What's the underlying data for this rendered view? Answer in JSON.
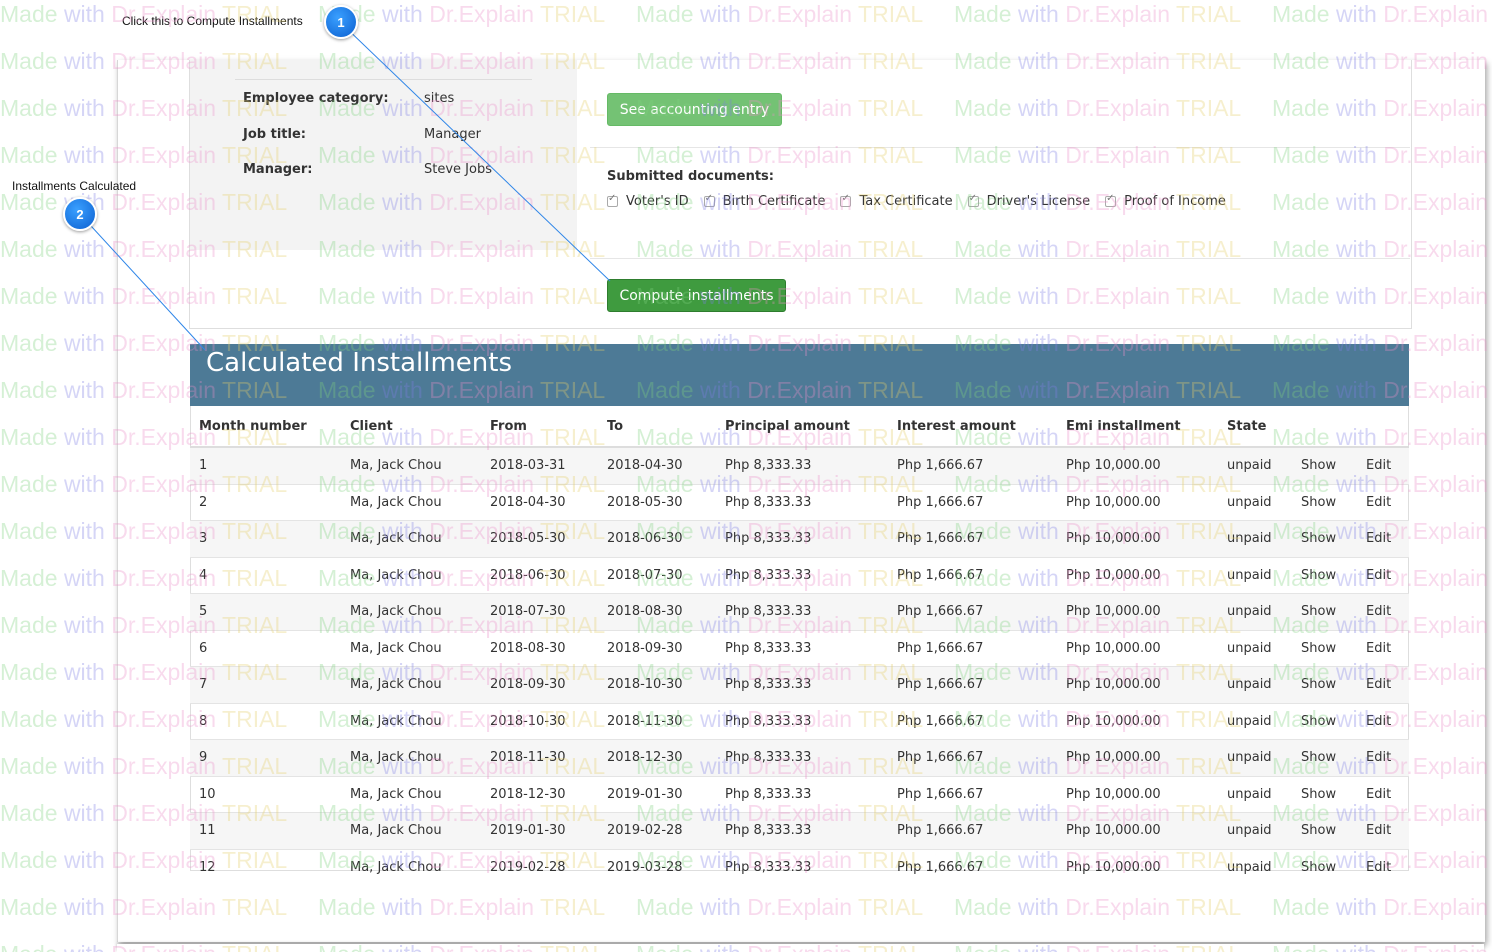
{
  "callouts": [
    {
      "number": "1",
      "text": "Click this to Compute Installments"
    },
    {
      "number": "2",
      "text": "Installments Calculated"
    }
  ],
  "employee": {
    "category_label": "Employee category:",
    "category_value": "sites",
    "job_title_label": "Job title:",
    "job_title_value": "Manager",
    "manager_label": "Manager:",
    "manager_value": "Steve Jobs"
  },
  "buttons": {
    "accounting_entry": "See accounting entry",
    "compute_installments": "Compute installments"
  },
  "documents": {
    "label": "Submitted documents:",
    "items": [
      {
        "label": "Voter's ID",
        "checked": true
      },
      {
        "label": "Birth Certificate",
        "checked": true
      },
      {
        "label": "Tax Certificate",
        "checked": true
      },
      {
        "label": "Driver's License",
        "checked": true
      },
      {
        "label": "Proof of Income",
        "checked": true
      }
    ]
  },
  "installments": {
    "title": "Calculated Installments",
    "columns": [
      "Month number",
      "Client",
      "From",
      "To",
      "Principal amount",
      "Interest amount",
      "Emi installment",
      "State",
      "",
      ""
    ],
    "show_label": "Show",
    "edit_label": "Edit",
    "rows": [
      {
        "month": "1",
        "client": "Ma, Jack Chou",
        "from": "2018-03-31",
        "to": "2018-04-30",
        "principal": "Php 8,333.33",
        "interest": "Php 1,666.67",
        "emi": "Php 10,000.00",
        "state": "unpaid"
      },
      {
        "month": "2",
        "client": "Ma, Jack Chou",
        "from": "2018-04-30",
        "to": "2018-05-30",
        "principal": "Php 8,333.33",
        "interest": "Php 1,666.67",
        "emi": "Php 10,000.00",
        "state": "unpaid"
      },
      {
        "month": "3",
        "client": "Ma, Jack Chou",
        "from": "2018-05-30",
        "to": "2018-06-30",
        "principal": "Php 8,333.33",
        "interest": "Php 1,666.67",
        "emi": "Php 10,000.00",
        "state": "unpaid"
      },
      {
        "month": "4",
        "client": "Ma, Jack Chou",
        "from": "2018-06-30",
        "to": "2018-07-30",
        "principal": "Php 8,333.33",
        "interest": "Php 1,666.67",
        "emi": "Php 10,000.00",
        "state": "unpaid"
      },
      {
        "month": "5",
        "client": "Ma, Jack Chou",
        "from": "2018-07-30",
        "to": "2018-08-30",
        "principal": "Php 8,333.33",
        "interest": "Php 1,666.67",
        "emi": "Php 10,000.00",
        "state": "unpaid"
      },
      {
        "month": "6",
        "client": "Ma, Jack Chou",
        "from": "2018-08-30",
        "to": "2018-09-30",
        "principal": "Php 8,333.33",
        "interest": "Php 1,666.67",
        "emi": "Php 10,000.00",
        "state": "unpaid"
      },
      {
        "month": "7",
        "client": "Ma, Jack Chou",
        "from": "2018-09-30",
        "to": "2018-10-30",
        "principal": "Php 8,333.33",
        "interest": "Php 1,666.67",
        "emi": "Php 10,000.00",
        "state": "unpaid"
      },
      {
        "month": "8",
        "client": "Ma, Jack Chou",
        "from": "2018-10-30",
        "to": "2018-11-30",
        "principal": "Php 8,333.33",
        "interest": "Php 1,666.67",
        "emi": "Php 10,000.00",
        "state": "unpaid"
      },
      {
        "month": "9",
        "client": "Ma, Jack Chou",
        "from": "2018-11-30",
        "to": "2018-12-30",
        "principal": "Php 8,333.33",
        "interest": "Php 1,666.67",
        "emi": "Php 10,000.00",
        "state": "unpaid"
      },
      {
        "month": "10",
        "client": "Ma, Jack Chou",
        "from": "2018-12-30",
        "to": "2019-01-30",
        "principal": "Php 8,333.33",
        "interest": "Php 1,666.67",
        "emi": "Php 10,000.00",
        "state": "unpaid"
      },
      {
        "month": "11",
        "client": "Ma, Jack Chou",
        "from": "2019-01-30",
        "to": "2019-02-28",
        "principal": "Php 8,333.33",
        "interest": "Php 1,666.67",
        "emi": "Php 10,000.00",
        "state": "unpaid"
      },
      {
        "month": "12",
        "client": "Ma, Jack Chou",
        "from": "2019-02-28",
        "to": "2019-03-28",
        "principal": "Php 8,333.33",
        "interest": "Php 1,666.67",
        "emi": "Php 10,000.00",
        "state": "unpaid"
      }
    ]
  },
  "watermark": {
    "made": "Made",
    "with": "with",
    "dr": "Dr.",
    "explain": "Explain",
    "trial": "TRIAL"
  },
  "colors": {
    "header_bg": "#4d7a96",
    "button_green": "#3f9b3f",
    "callout_blue": "#1a7be8"
  }
}
